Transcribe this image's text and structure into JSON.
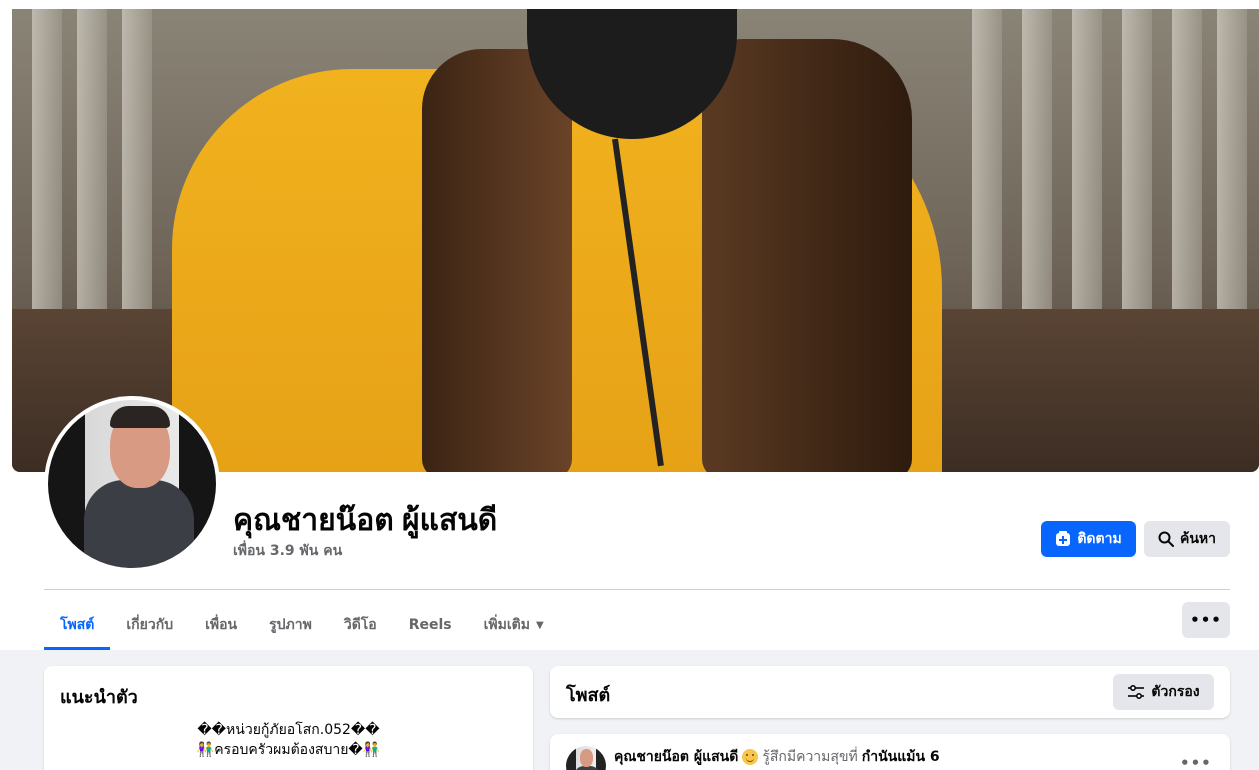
{
  "profile": {
    "name": "คุณชายน๊อต ผู้แสนดี",
    "friends": "เพื่อน 3.9 พัน คน"
  },
  "actions": {
    "follow_label": "ติดตาม",
    "search_label": "ค้นหา",
    "more_label": "•••"
  },
  "tabs": [
    {
      "label": "โพสต์",
      "active": true
    },
    {
      "label": "เกี่ยวกับ"
    },
    {
      "label": "เพื่อน"
    },
    {
      "label": "รูปภาพ"
    },
    {
      "label": "วิดีโอ"
    },
    {
      "label": "Reels"
    },
    {
      "label": "เพิ่มเติม"
    }
  ],
  "intro": {
    "title": "แนะนำตัว",
    "bio_line1": "��หน่วยกู้ภัยอโสก.052��",
    "bio_line2": "👫ครอบครัวผมต้องสบาย�👫"
  },
  "posts": {
    "title": "โพสต์",
    "filter_label": "ตัวกรอง"
  },
  "first_post": {
    "author": "คุณชายน๊อต ผู้แสนดี",
    "feeling": "รู้สึกมีความสุขที่",
    "tagged": "กำนันแม้น 6",
    "more": "•••"
  },
  "colors": {
    "accent": "#0866ff",
    "secondary_button": "#e4e6eb",
    "page_background": "#f0f2f5",
    "secondary_text": "#65676b"
  }
}
